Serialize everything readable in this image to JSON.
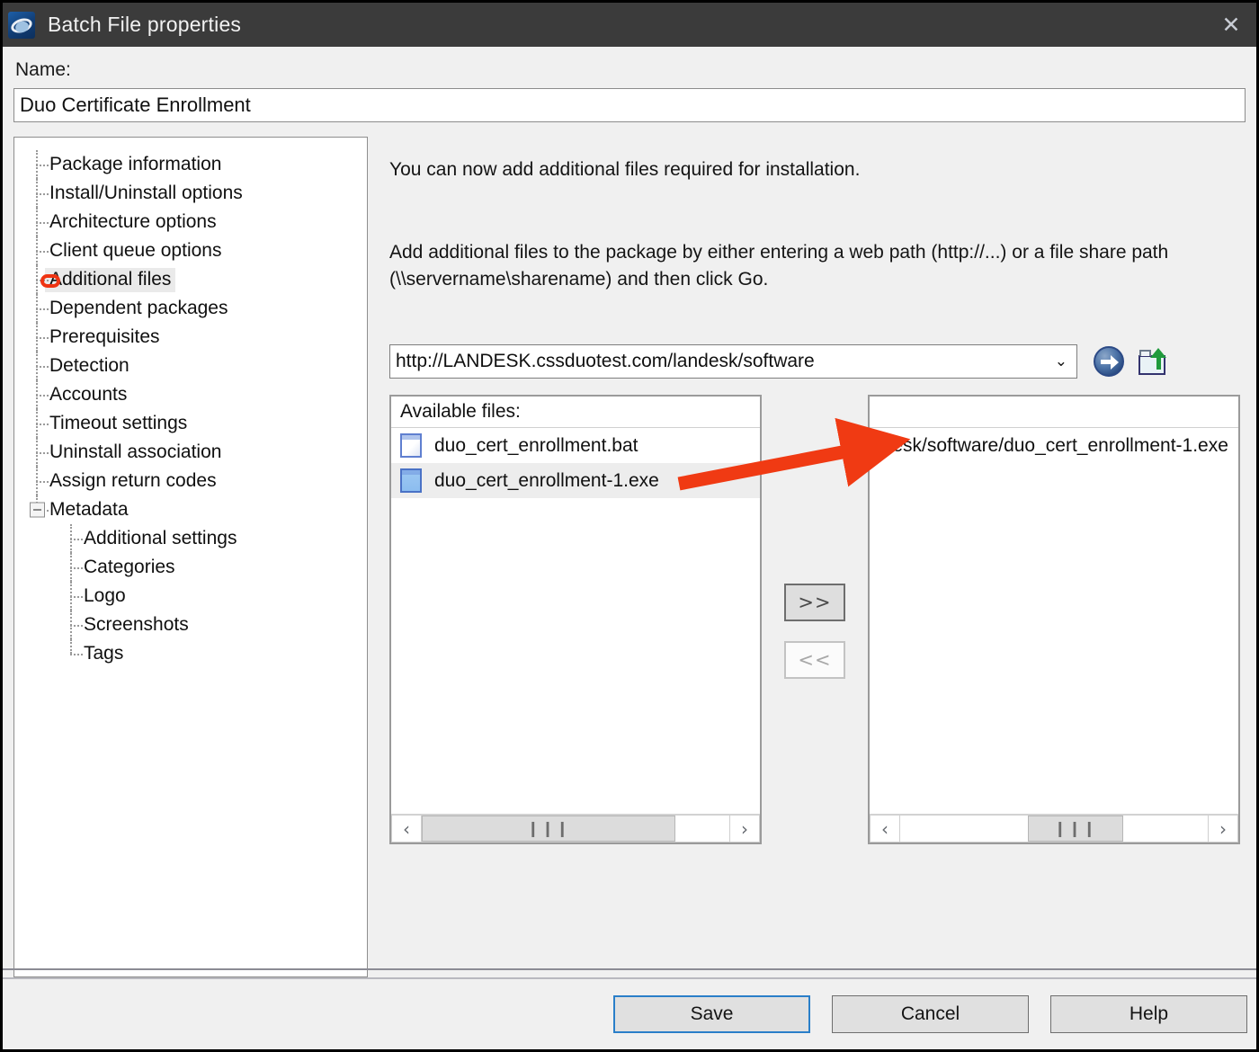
{
  "window": {
    "title": "Batch File properties",
    "app_icon": "ivanti-logo-icon",
    "close_label": "✕"
  },
  "name_field": {
    "label": "Name:",
    "value": "Duo Certificate Enrollment"
  },
  "tree": {
    "items": [
      {
        "label": "Package information",
        "level": 0,
        "selected": false
      },
      {
        "label": "Install/Uninstall options",
        "level": 0,
        "selected": false
      },
      {
        "label": "Architecture options",
        "level": 0,
        "selected": false
      },
      {
        "label": "Client queue options",
        "level": 0,
        "selected": false
      },
      {
        "label": "Additional files",
        "level": 0,
        "selected": true
      },
      {
        "label": "Dependent packages",
        "level": 0,
        "selected": false
      },
      {
        "label": "Prerequisites",
        "level": 0,
        "selected": false
      },
      {
        "label": "Detection",
        "level": 0,
        "selected": false
      },
      {
        "label": "Accounts",
        "level": 0,
        "selected": false
      },
      {
        "label": "Timeout settings",
        "level": 0,
        "selected": false
      },
      {
        "label": "Uninstall association",
        "level": 0,
        "selected": false
      },
      {
        "label": "Assign return codes",
        "level": 0,
        "selected": false
      },
      {
        "label": "Metadata",
        "level": 0,
        "selected": false,
        "expander": "minus"
      },
      {
        "label": "Additional settings",
        "level": 1,
        "selected": false
      },
      {
        "label": "Categories",
        "level": 1,
        "selected": false
      },
      {
        "label": "Logo",
        "level": 1,
        "selected": false
      },
      {
        "label": "Screenshots",
        "level": 1,
        "selected": false
      },
      {
        "label": "Tags",
        "level": 1,
        "selected": false
      }
    ]
  },
  "main": {
    "intro_line": "You can now add additional files required for installation.",
    "instruction_line": "Add additional files to the package by either entering a web path (http://...) or a file share path (\\\\servername\\sharename) and then click Go.",
    "path_combo": {
      "value": "http://LANDESK.cssduotest.com/landesk/software",
      "caret": "⌄"
    },
    "go_icon": "go-arrow-icon",
    "browse_icon": "folder-upload-icon",
    "available": {
      "header": "Available files:",
      "files": [
        {
          "name": "duo_cert_enrollment.bat",
          "icon": "file-icon",
          "selected": false
        },
        {
          "name": "duo_cert_enrollment-1.exe",
          "icon": "file-icon",
          "selected": true
        }
      ],
      "scroll_left": "‹",
      "scroll_right": "›",
      "grip": "❙❙❙"
    },
    "selected_list": {
      "header": "",
      "files": [
        {
          "name": "ndesk/software/duo_cert_enrollment-1.exe"
        }
      ],
      "scroll_left": "‹",
      "scroll_right": "›",
      "grip": "❙❙❙"
    },
    "add_button": ">>",
    "remove_button": "<<"
  },
  "footer": {
    "save": "Save",
    "cancel": "Cancel",
    "help": "Help"
  },
  "annotations": {
    "arrow_color": "#f03a13",
    "ring_color": "#ef3413",
    "ring_target": "Additional files",
    "arrow_from": "duo_cert_enrollment-1.exe",
    "arrow_to": "ndesk/software/duo_cert_enrollment-1.exe"
  }
}
